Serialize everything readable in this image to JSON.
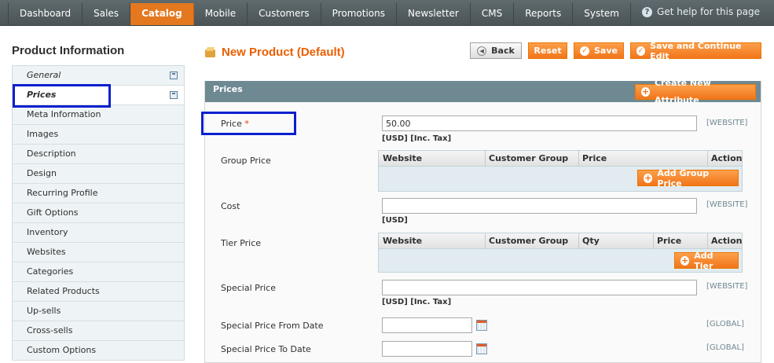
{
  "nav": {
    "items": [
      "Dashboard",
      "Sales",
      "Catalog",
      "Mobile",
      "Customers",
      "Promotions",
      "Newsletter",
      "CMS",
      "Reports",
      "System"
    ],
    "active_index": 2,
    "help_label": "Get help for this page"
  },
  "sidebar": {
    "title": "Product Information",
    "items": [
      {
        "label": "General"
      },
      {
        "label": "Prices"
      },
      {
        "label": "Meta Information"
      },
      {
        "label": "Images"
      },
      {
        "label": "Description"
      },
      {
        "label": "Design"
      },
      {
        "label": "Recurring Profile"
      },
      {
        "label": "Gift Options"
      },
      {
        "label": "Inventory"
      },
      {
        "label": "Websites"
      },
      {
        "label": "Categories"
      },
      {
        "label": "Related Products"
      },
      {
        "label": "Up-sells"
      },
      {
        "label": "Cross-sells"
      },
      {
        "label": "Custom Options"
      }
    ],
    "selected_index": 1
  },
  "header": {
    "title": "New Product (Default)",
    "back_label": "Back",
    "reset_label": "Reset",
    "save_label": "Save",
    "save_continue_label": "Save and Continue Edit"
  },
  "section": {
    "title": "Prices",
    "create_attr_label": "Create New Attribute",
    "price": {
      "label": "Price",
      "required_mark": "*",
      "value": "50.00",
      "scope": "[WEBSITE]",
      "note": "[USD] [Inc. Tax]"
    },
    "group_price": {
      "label": "Group Price",
      "columns": [
        "Website",
        "Customer Group",
        "Price",
        "Action"
      ],
      "add_label": "Add Group Price"
    },
    "cost": {
      "label": "Cost",
      "value": "",
      "scope": "[WEBSITE]",
      "note": "[USD]"
    },
    "tier_price": {
      "label": "Tier Price",
      "columns": [
        "Website",
        "Customer Group",
        "Qty",
        "Price",
        "Action"
      ],
      "add_label": "Add Tier"
    },
    "special_price": {
      "label": "Special Price",
      "value": "",
      "scope": "[WEBSITE]",
      "note": "[USD] [Inc. Tax]"
    },
    "special_from": {
      "label": "Special Price From Date",
      "value": "",
      "scope": "[GLOBAL]"
    },
    "special_to": {
      "label": "Special Price To Date",
      "value": "",
      "scope": "[GLOBAL]"
    }
  },
  "colors": {
    "accent": "#eb5e00",
    "nav_bg": "#4b5558",
    "section_header": "#6f8992",
    "highlight": "#0a1fcf"
  }
}
